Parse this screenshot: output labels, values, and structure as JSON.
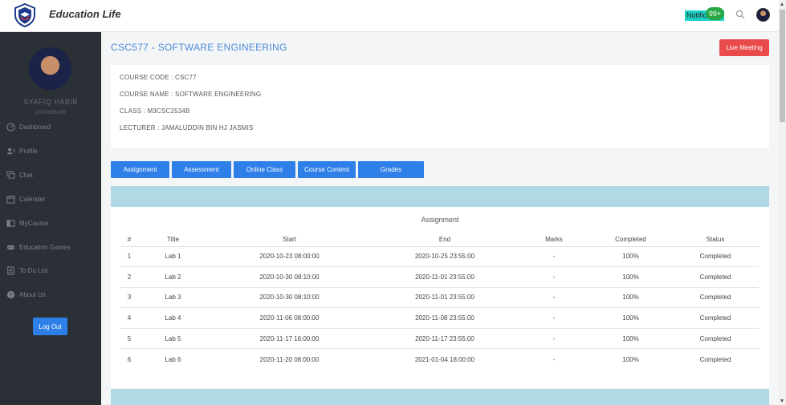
{
  "header": {
    "app_title": "Education Life",
    "notification_label": "Notification",
    "notification_count": "99+"
  },
  "sidebar": {
    "user_name": "SYAFIQ HABIB",
    "user_id": "2020996495",
    "items": [
      {
        "label": "Dashboard",
        "icon": "dashboard-icon"
      },
      {
        "label": "Profile",
        "icon": "profile-icon"
      },
      {
        "label": "Chat",
        "icon": "chat-icon"
      },
      {
        "label": "Calender",
        "icon": "calendar-icon"
      },
      {
        "label": "MyCourse",
        "icon": "course-icon"
      },
      {
        "label": "Education Games",
        "icon": "gamepad-icon"
      },
      {
        "label": "To Do List",
        "icon": "todo-icon"
      },
      {
        "label": "About Us",
        "icon": "info-icon"
      }
    ],
    "logout_label": "Log Out"
  },
  "main": {
    "title": "CSC577 - SOFTWARE ENGINEERING",
    "live_meeting_label": "Live Meeting",
    "course_info": {
      "code": "COURSE CODE : CSC77",
      "name": "COURSE NAME : SOFTWARE ENGINEERING",
      "class": "CLASS : M3CSC2534B",
      "lecturer": "LECTURER : JAMALUDDIN BIN HJ JASMIS"
    },
    "tabs": [
      "Assignment",
      "Assessment",
      "Online Class",
      "Course Content",
      "Grades"
    ],
    "table": {
      "caption": "Assignment",
      "columns": [
        "#",
        "Title",
        "Start",
        "End",
        "Marks",
        "Completed",
        "Status"
      ],
      "rows": [
        [
          "1",
          "Lab 1",
          "2020-10-23 08:00:00",
          "2020-10-25 23:55:00",
          "-",
          "100%",
          "Completed"
        ],
        [
          "2",
          "Lab 2",
          "2020-10-30 08:10:00",
          "2020-11-01 23:55:00",
          "-",
          "100%",
          "Completed"
        ],
        [
          "3",
          "Lab 3",
          "2020-10-30 08:10:00",
          "2020-11-01 23:55:00",
          "-",
          "100%",
          "Completed"
        ],
        [
          "4",
          "Lab 4",
          "2020-11-06 08:00:00",
          "2020-11-08 23:55:00",
          "-",
          "100%",
          "Completed"
        ],
        [
          "5",
          "Lab 5",
          "2020-11-17 16:00:00",
          "2020-11-17 23:55:00",
          "-",
          "100%",
          "Completed"
        ],
        [
          "6",
          "Lab 6",
          "2020-11-20 08:00:00",
          "2021-01-04 18:00:00",
          "-",
          "100%",
          "Completed"
        ]
      ]
    }
  },
  "colors": {
    "accent": "#2f7fe8",
    "danger": "#e94b4b",
    "sidebar_bg": "#2b3036",
    "band": "#b0d9e5",
    "title": "#4a8bd8"
  }
}
